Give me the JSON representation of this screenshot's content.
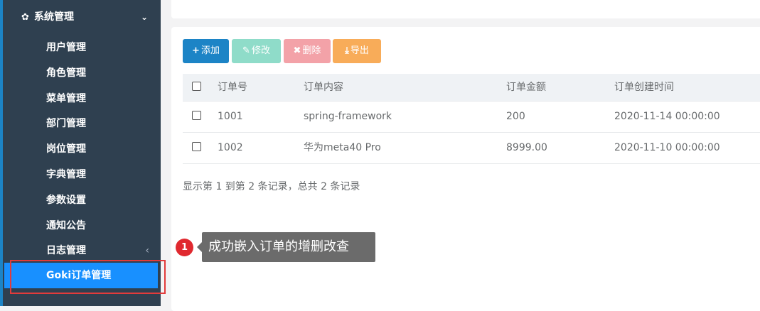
{
  "sidebar": {
    "section_title": "系统管理",
    "items": [
      {
        "label": "用户管理"
      },
      {
        "label": "角色管理"
      },
      {
        "label": "菜单管理"
      },
      {
        "label": "部门管理"
      },
      {
        "label": "岗位管理"
      },
      {
        "label": "字典管理"
      },
      {
        "label": "参数设置"
      },
      {
        "label": "通知公告"
      },
      {
        "label": "日志管理"
      }
    ],
    "active_item": "Goki订单管理"
  },
  "toolbar": {
    "add_label": "添加",
    "edit_label": "修改",
    "delete_label": "删除",
    "export_label": "导出"
  },
  "table": {
    "headers": [
      "订单号",
      "订单内容",
      "订单金额",
      "订单创建时间"
    ],
    "rows": [
      {
        "order_no": "1001",
        "content": "spring-framework",
        "amount": "200",
        "created": "2020-11-14 00:00:00"
      },
      {
        "order_no": "1002",
        "content": "华为meta40 Pro",
        "amount": "8999.00",
        "created": "2020-11-10 00:00:00"
      }
    ]
  },
  "pager": {
    "summary": "显示第 1 到第 2 条记录，总共 2 条记录"
  },
  "callout": {
    "number": "1",
    "text": "成功嵌入订单的增删改查"
  },
  "colors": {
    "sidebar_bg": "#2f4050",
    "active_bg": "#1890ff",
    "primary": "#1c84c6",
    "highlight_border": "#e23b3b"
  }
}
